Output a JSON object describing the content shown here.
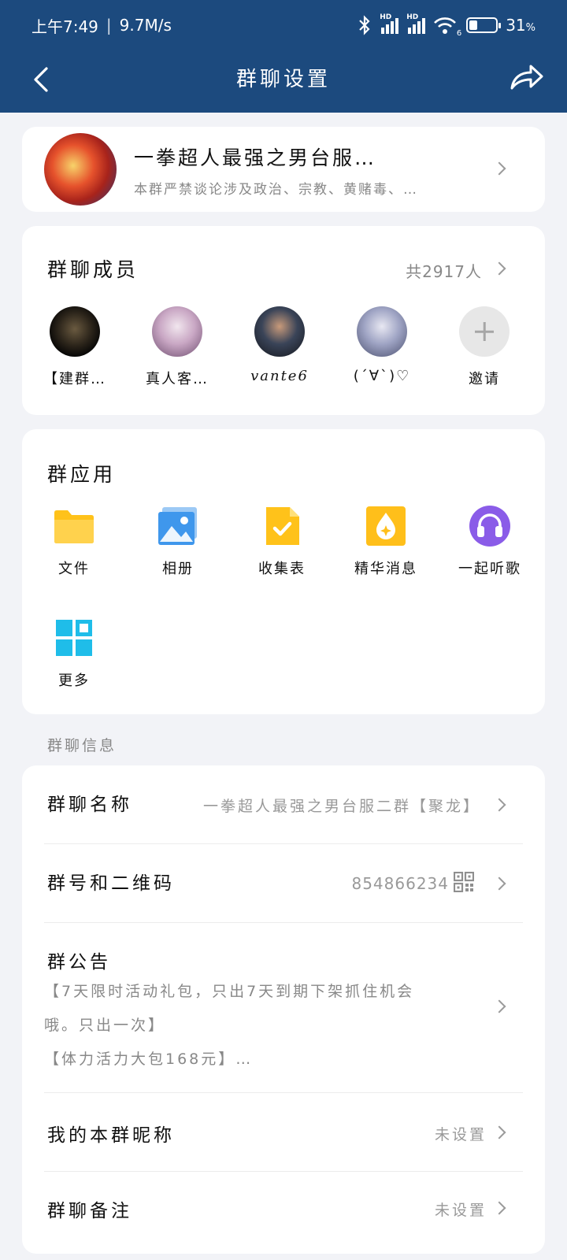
{
  "status_bar": {
    "time": "上午7:49",
    "speed": "9.7M/s",
    "signal_1_label": "HD",
    "signal_2_label": "HD",
    "wifi_badge": "6",
    "battery_percent": "31",
    "battery_level": 0.31,
    "icons": [
      "bluetooth-icon",
      "signal-icon",
      "wifi-icon",
      "battery-icon"
    ]
  },
  "nav": {
    "title": "群聊设置",
    "back_icon": "chevron-left-icon",
    "share_icon": "share-icon"
  },
  "group": {
    "name": "一拳超人最强之男台服…",
    "description": "本群严禁谈论涉及政治、宗教、黄赌毒、…"
  },
  "members": {
    "title": "群聊成员",
    "count": "共2917人",
    "list": [
      {
        "name": "【建群…"
      },
      {
        "name": "真人客…"
      },
      {
        "name": "vante6"
      },
      {
        "name": "(ˊ∀ˋ)♡"
      }
    ],
    "invite_label": "邀请"
  },
  "apps": {
    "title": "群应用",
    "items": [
      {
        "label": "文件",
        "icon": "folder-icon"
      },
      {
        "label": "相册",
        "icon": "photo-album-icon"
      },
      {
        "label": "收集表",
        "icon": "form-icon"
      },
      {
        "label": "精华消息",
        "icon": "essence-icon"
      },
      {
        "label": "一起听歌",
        "icon": "headphones-icon"
      },
      {
        "label": "更多",
        "icon": "more-apps-icon"
      }
    ]
  },
  "info": {
    "section_label": "群聊信息",
    "name_label": "群聊名称",
    "name_value": "一拳超人最强之男台服二群【聚龙】",
    "number_label": "群号和二维码",
    "number_value": "854866234",
    "notice_label": "群公告",
    "notice_line1": "【7天限时活动礼包，只出7天到期下架抓住机会",
    "notice_line2": "哦。只出一次】",
    "notice_line3": "【体力活力大包168元】…",
    "nickname_label": "我的本群昵称",
    "nickname_value": "未设置",
    "remark_label": "群聊备注",
    "remark_value": "未设置"
  },
  "colors": {
    "header": "#1c4a7e",
    "background": "#f2f3f7",
    "folder": "#ffc21a",
    "album": "#3f97ec",
    "form": "#ffc21a",
    "essence": "#ffbf1a",
    "headphones": "#8a5ce8",
    "more": "#1fbde9"
  }
}
